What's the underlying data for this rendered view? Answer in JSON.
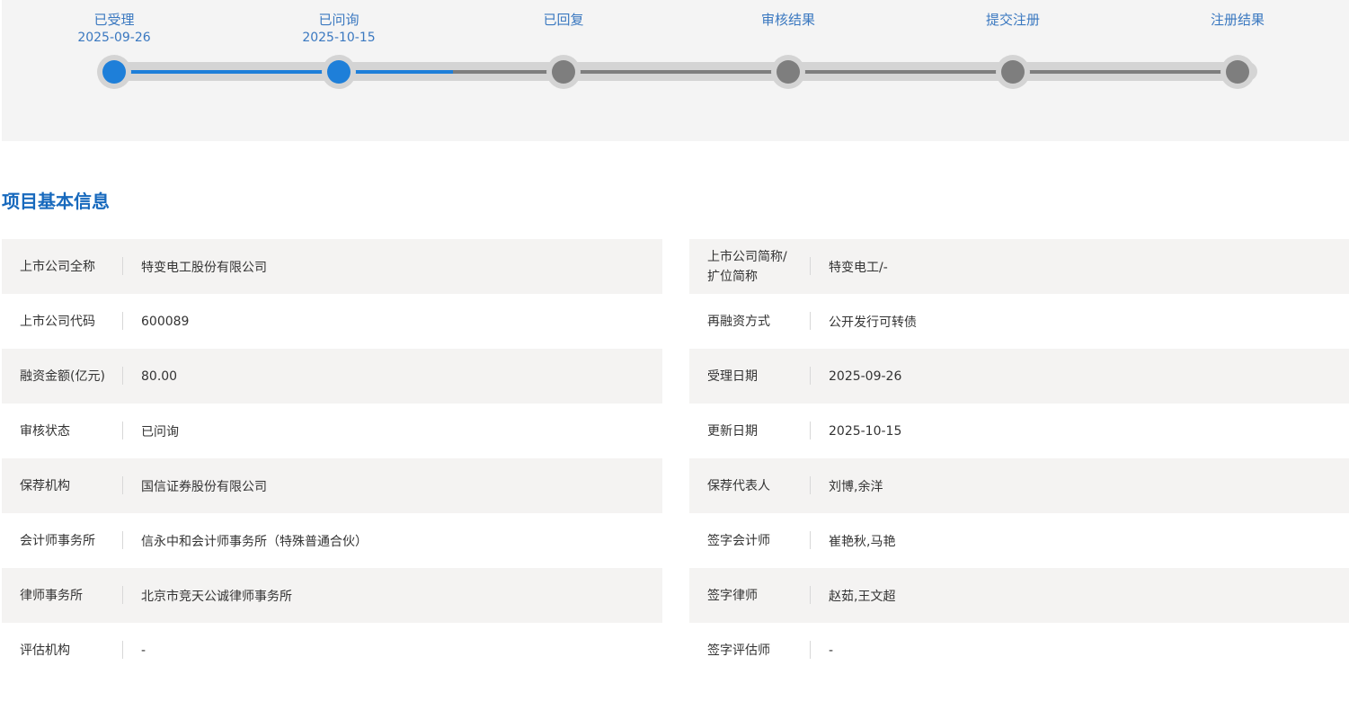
{
  "progress": {
    "steps": [
      {
        "label": "已受理",
        "date": "2025-09-26",
        "active": true
      },
      {
        "label": "已问询",
        "date": "2025-10-15",
        "active": true
      },
      {
        "label": "已回复",
        "date": "",
        "active": false
      },
      {
        "label": "审核结果",
        "date": "",
        "active": false
      },
      {
        "label": "提交注册",
        "date": "",
        "active": false
      },
      {
        "label": "注册结果",
        "date": "",
        "active": false
      }
    ],
    "colors": {
      "active": "#1e7fd9",
      "inactive": "#7e7e7e",
      "track": "#d4d4d4"
    }
  },
  "section": {
    "title": "项目基本信息"
  },
  "info": {
    "left": [
      {
        "label": "上市公司全称",
        "value": "特变电工股份有限公司"
      },
      {
        "label": "上市公司代码",
        "value": "600089"
      },
      {
        "label": "融资金额(亿元)",
        "value": "80.00"
      },
      {
        "label": "审核状态",
        "value": "已问询"
      },
      {
        "label": "保荐机构",
        "value": "国信证券股份有限公司"
      },
      {
        "label": "会计师事务所",
        "value": "信永中和会计师事务所（特殊普通合伙）"
      },
      {
        "label": "律师事务所",
        "value": "北京市竞天公诚律师事务所"
      },
      {
        "label": "评估机构",
        "value": "-"
      }
    ],
    "right": [
      {
        "label": "上市公司简称/扩位简称",
        "value": "特变电工/-"
      },
      {
        "label": "再融资方式",
        "value": "公开发行可转债"
      },
      {
        "label": "受理日期",
        "value": "2025-09-26"
      },
      {
        "label": "更新日期",
        "value": "2025-10-15"
      },
      {
        "label": "保荐代表人",
        "value": "刘博,余洋"
      },
      {
        "label": "签字会计师",
        "value": "崔艳秋,马艳"
      },
      {
        "label": "签字律师",
        "value": "赵茹,王文超"
      },
      {
        "label": "签字评估师",
        "value": "-"
      }
    ]
  }
}
